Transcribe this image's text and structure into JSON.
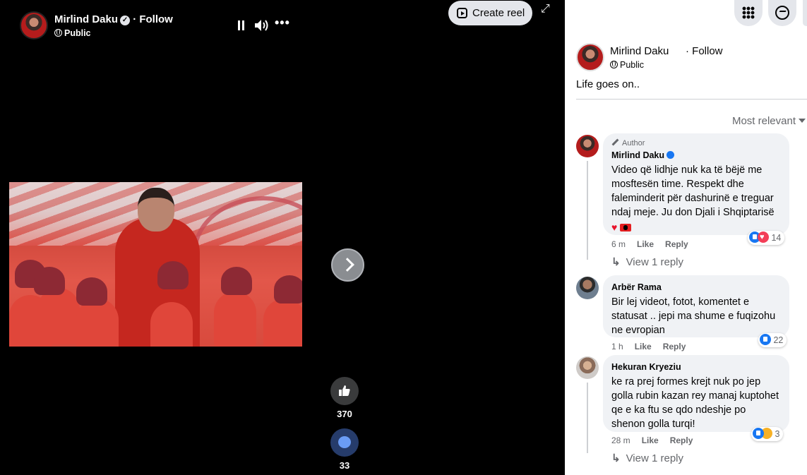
{
  "reel": {
    "owner_name": "Mirlind Daku",
    "follow_label": "· Follow",
    "audience": "Public",
    "create_reel_label": "Create reel",
    "like_count": "370",
    "comment_count": "33",
    "icons": [
      "pause-icon",
      "volume-icon",
      "more-icon",
      "reel-icon",
      "expand-icon",
      "chevron-right-icon",
      "thumbs-up-icon",
      "comment-icon"
    ]
  },
  "post": {
    "author": "Mirlind Daku",
    "follow_label": "· Follow",
    "audience": "Public",
    "text": "Life goes on..",
    "sort_label": "Most relevant"
  },
  "comments": [
    {
      "badge": "Author",
      "name": "Mirlind Daku",
      "verified": true,
      "text": "Video që lidhje nuk ka të bëjë me mosftesën time. Respekt dhe faleminderit për dashurinë e treguar ndaj meje. Ju don Djali i Shqiptarisë",
      "time": "6 m",
      "like_label": "Like",
      "reply_label": "Reply",
      "reaction_count": "14",
      "view_replies": "View 1 reply"
    },
    {
      "name": "Arbër Rama",
      "text": "Bir lej videot, fotot, komentet e statusat .. jepi ma shume e fuqizohu ne evropian",
      "time": "1 h",
      "like_label": "Like",
      "reply_label": "Reply",
      "reaction_count": "22"
    },
    {
      "name": "Hekuran Kryeziu",
      "text": "ke ra prej formes krejt nuk po jep golla rubin kazan rey manaj kuptohet qe e ka ftu se qdo ndeshje po shenon golla turqi!",
      "time": "28 m",
      "like_label": "Like",
      "reply_label": "Reply",
      "reaction_count": "3",
      "view_replies": "View 1 reply"
    }
  ],
  "colors": {
    "accent": "#1877f2",
    "bubble_bg": "#f0f2f5",
    "secondary_text": "#65676b"
  }
}
